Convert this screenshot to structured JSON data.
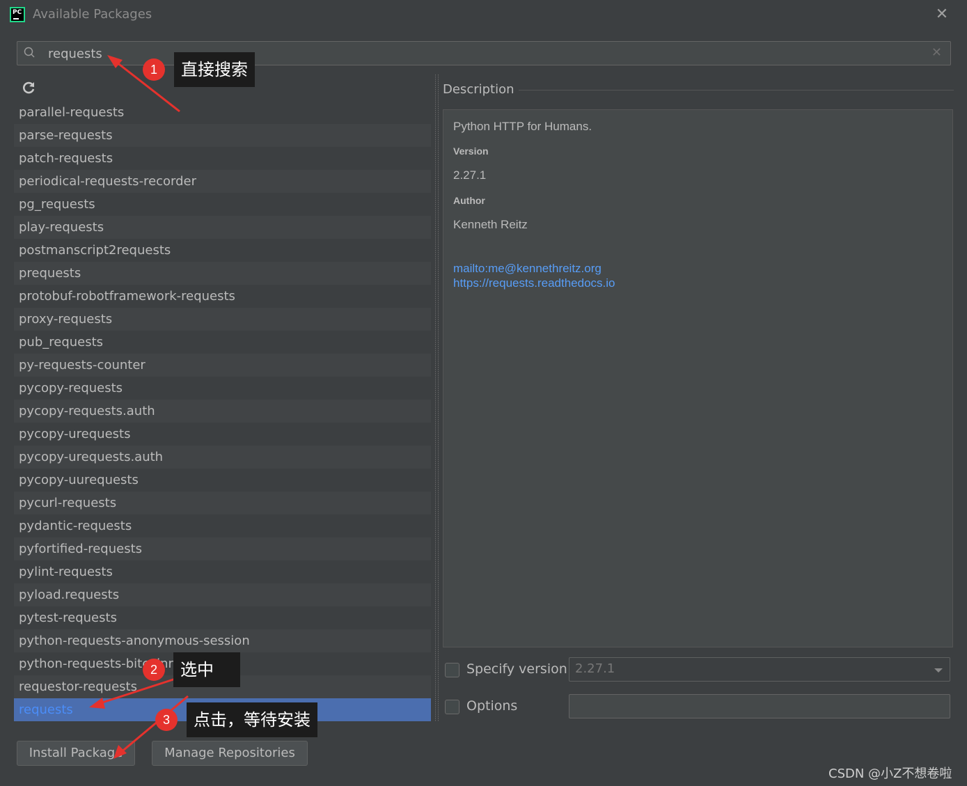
{
  "window": {
    "title": "Available Packages",
    "close_symbol": "✕"
  },
  "search": {
    "value": "requests",
    "clear_symbol": "✕"
  },
  "packages": [
    "parallel-requests",
    "parse-requests",
    "patch-requests",
    "periodical-requests-recorder",
    "pg_requests",
    "play-requests",
    "postmanscript2requests",
    "prequests",
    "protobuf-robotframework-requests",
    "proxy-requests",
    "pub_requests",
    "py-requests-counter",
    "pycopy-requests",
    "pycopy-requests.auth",
    "pycopy-urequests",
    "pycopy-urequests.auth",
    "pycopy-uurequests",
    "pycurl-requests",
    "pydantic-requests",
    "pyfortified-requests",
    "pylint-requests",
    "pyload.requests",
    "pytest-requests",
    "python-requests-anonymous-session",
    "python-requests-bitcoinrpc",
    "requestor-requests",
    "requests"
  ],
  "selected_package": "requests",
  "description": {
    "header": "Description",
    "summary": "Python HTTP for Humans.",
    "version_label": "Version",
    "version_value": "2.27.1",
    "author_label": "Author",
    "author_value": "Kenneth Reitz",
    "link_email": "mailto:me@kennethreitz.org",
    "link_docs": "https://requests.readthedocs.io"
  },
  "options": {
    "specify_version_label": "Specify version",
    "version_value": "2.27.1",
    "options_label": "Options",
    "options_value": ""
  },
  "buttons": {
    "install": "Install Package",
    "manage": "Manage Repositories"
  },
  "annotations": {
    "step1_number": "1",
    "step1_text": "直接搜索",
    "step2_number": "2",
    "step2_text": "选中",
    "step3_number": "3",
    "step3_text": "点击，等待安装"
  },
  "watermark": "CSDN @小Z不想卷啦",
  "colors": {
    "background": "#3c3f41",
    "selection": "#4b6eaf",
    "link": "#589df6",
    "annotation_red": "#e5322d"
  }
}
